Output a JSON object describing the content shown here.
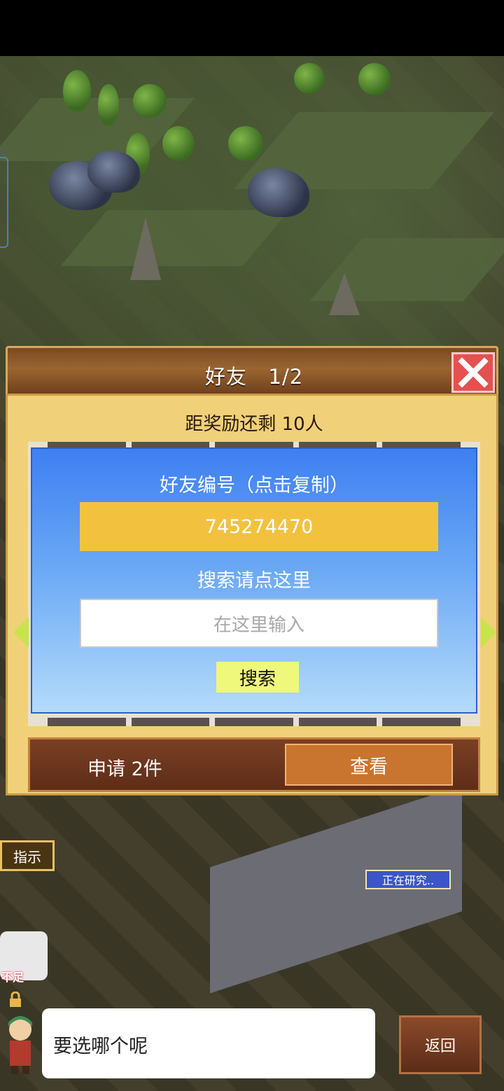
{
  "dialog": {
    "title": "好友",
    "page": "1/2",
    "reward_text": "距奖励还剩 10人",
    "friend_id_label": "好友编号（点击复制）",
    "friend_id": "745274470",
    "search_label": "搜索请点这里",
    "search_placeholder": "在这里输入",
    "search_button": "搜索",
    "requests_text": "申请 2件",
    "view_button": "查看"
  },
  "scene": {
    "hint_label": "指示",
    "researching_label": "正在研究..",
    "lack_label": "不足",
    "message": "要选哪个呢",
    "back_button": "返回"
  },
  "colors": {
    "panel_blue": "#3f7ff2",
    "id_yellow": "#f2c23f",
    "search_btn": "#eff87a",
    "close_red": "#e65050",
    "dialog_gold": "#f0d079"
  },
  "icons": [
    "close-icon",
    "arrow-left-icon",
    "arrow-right-icon",
    "lock-icon",
    "avatar-icon"
  ]
}
